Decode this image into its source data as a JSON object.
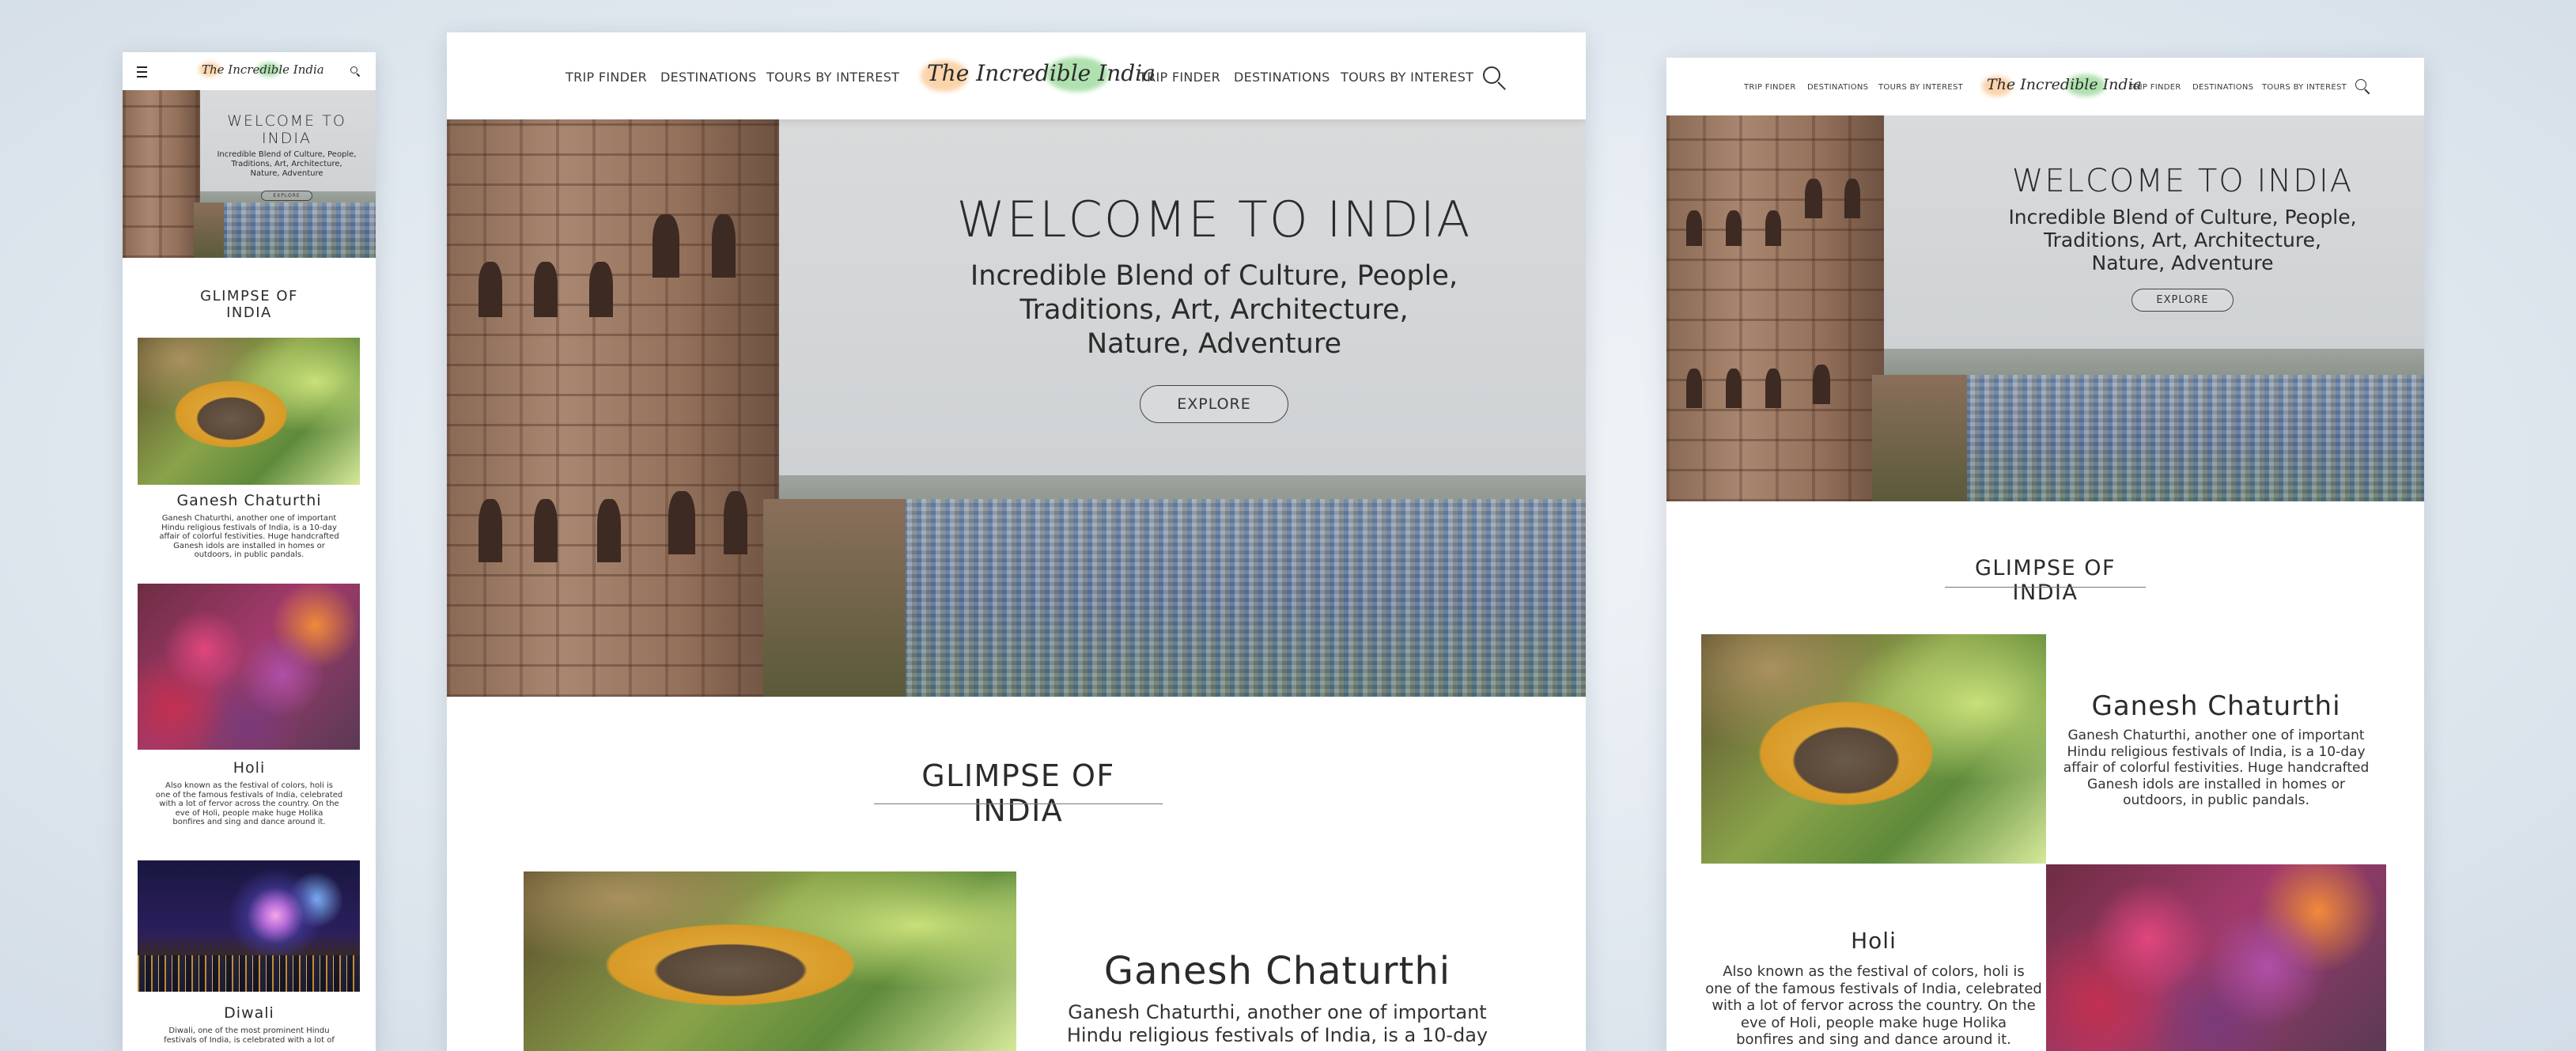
{
  "nav": {
    "items": [
      "TRIP FINDER",
      "DESTINATIONS",
      "TOURS BY INTEREST"
    ],
    "logo": "The Incredible India",
    "menu_icon": "hamburger-menu-icon",
    "search_icon": "search-icon"
  },
  "hero": {
    "title": "WELCOME TO INDIA",
    "subtitle": "Incredible Blend of Culture, People, Traditions, Art, Architecture, Nature, Adventure",
    "subtitle_line1": "Incredible Blend of Culture, People,",
    "subtitle_line2": "Traditions, Art, Architecture,",
    "subtitle_line3": "Nature, Adventure",
    "mobile_line1": "Incredible Blend of Culture, People,",
    "mobile_line2": "Traditions, Art, Architecture,",
    "mobile_line3": "Nature, Adventure",
    "button": "EXPLORE"
  },
  "section": {
    "title": "GLIMPSE OF INDIA"
  },
  "festivals": [
    {
      "name": "Ganesh Chaturthi",
      "desc": "Ganesh Chaturthi, another one of important Hindu religious festivals of India, is a 10-day affair of colorful festivities. Huge handcrafted Ganesh idols are installed in homes or outdoors, in public pandals.",
      "l1": "Ganesh Chaturthi, another one of important",
      "l2": "Hindu religious festivals of India, is a 10-day",
      "l3": "affair of colorful festivities. Huge handcrafted",
      "l4": "Ganesh idols are installed in homes or",
      "l5": "outdoors, in public pandals."
    },
    {
      "name": "Holi",
      "desc": "Also known as the festival of colors, holi is one of the famous festivals of India, celebrated with a lot of fervor across the country. On the eve of Holi, people make huge Holika bonfires and sing and dance around it.",
      "l1": "Also known as the festival of colors, holi is",
      "l2": "one of the famous festivals of India, celebrated",
      "l3": "with a lot of fervor across the country. On the",
      "l4": "eve of Holi, people make huge Holika",
      "l5": "bonfires and sing and dance around it."
    },
    {
      "name": "Diwali",
      "l1": "Diwali, one of the most prominent Hindu",
      "l2": "festivals of India, is celebrated with a lot of"
    }
  ],
  "colors": {
    "background": "#e2e9f0",
    "logo_orange": "#f7b066",
    "logo_green": "#6ec86e",
    "text": "#2d2d2d"
  }
}
